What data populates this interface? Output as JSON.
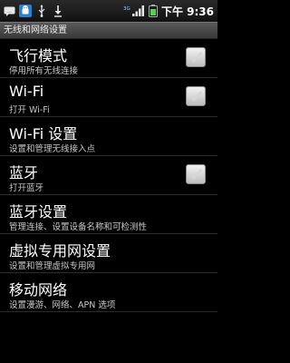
{
  "status_bar": {
    "time": "下午 9:36",
    "left_icons": [
      "sms-icon",
      "android-icon",
      "usb-icon",
      "download-icon"
    ],
    "right_icons": [
      "3g-signal-icon",
      "battery-icon"
    ]
  },
  "header": {
    "title": "无线和网络设置"
  },
  "settings": {
    "items": [
      {
        "title": "飞行模式",
        "summary": "停用所有无线连接",
        "has_checkbox": true,
        "checked": false
      },
      {
        "title": "Wi-Fi",
        "summary": "打开 Wi-Fi",
        "has_checkbox": true,
        "checked": false
      },
      {
        "title": "Wi-Fi 设置",
        "summary": "设置和管理无线接入点",
        "has_checkbox": false
      },
      {
        "title": "蓝牙",
        "summary": "打开蓝牙",
        "has_checkbox": true,
        "checked": false
      },
      {
        "title": "蓝牙设置",
        "summary": "管理连接、设置设备名称和可检测性",
        "has_checkbox": false
      },
      {
        "title": "虚拟专用网设置",
        "summary": "设置和管理虚拟专用网",
        "has_checkbox": false
      },
      {
        "title": "移动网络",
        "summary": "设置漫游、网络、APN 选项",
        "has_checkbox": false
      }
    ]
  }
}
